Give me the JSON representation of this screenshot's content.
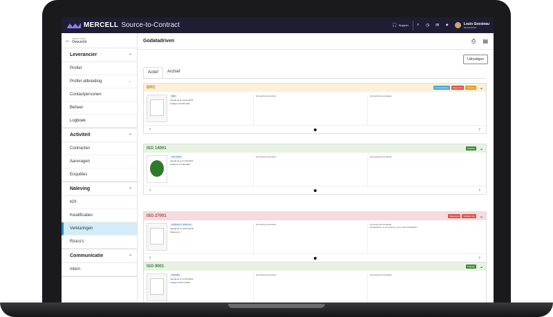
{
  "app": {
    "brand": "MERCELL",
    "product": "Source-to-Contract"
  },
  "topbar": {
    "support_label": "Support",
    "user_name": "Louis Gossieau",
    "user_role": "BEHEERDER"
  },
  "sidebar": {
    "back_small": "TERUG NAAR",
    "back_label": "Overzicht",
    "groups": [
      {
        "title": "Leverancier",
        "items": [
          "Profiel",
          "Profiel uitbreiding",
          "Contactpersonen",
          "Beheer",
          "Logboek"
        ]
      },
      {
        "title": "Activiteit",
        "items": [
          "Contracten",
          "Aanvragen",
          "Enquêtes"
        ]
      },
      {
        "title": "Naleving",
        "items": [
          "KPI",
          "Kwalificaties",
          "Verklaringen",
          "Risico's"
        ]
      },
      {
        "title": "Communicatie",
        "items": [
          "Intern"
        ]
      }
    ]
  },
  "main": {
    "title": "Godatadriven",
    "invite_label": "Uitnodigen",
    "tabs": [
      "Actief",
      "Archief"
    ],
    "col1_label": "Opmerking transmitter",
    "col2_label": "Opmerking beoordelaar",
    "cards": [
      {
        "title": "BRC",
        "file": "BRC",
        "line1": "Ingediend op 25-11-2023",
        "line2": "Geldig tot 26-05-2021",
        "col2_text": "",
        "badges": [
          {
            "label": "In behandeling",
            "color": "#4aa8d8"
          },
          {
            "label": "Uitgevoerd",
            "color": "#d9534f"
          },
          {
            "label": "Verlopen",
            "color": "#e59a2b"
          }
        ]
      },
      {
        "title": "ISO 14001",
        "file": "ISO 14001",
        "line1": "Ingediend op 27-08-2021",
        "line2": "Geldig tot 27-08-2023",
        "col2_text": "",
        "badges": [
          {
            "label": "Voldaan",
            "color": "#4a8a3a"
          }
        ]
      },
      {
        "title": "ISO 27001",
        "file": "certificate in ENG.key",
        "line1": "Ingediend op 09-09-2016",
        "line2": "Afgewezen",
        "col2_text": "Godatadriven is not listed as one of the subsidiaries.",
        "badges": [
          {
            "label": "Uitgevoerd",
            "color": "#d9534f"
          },
          {
            "label": "Voldaan niet",
            "color": "#d9534f"
          }
        ]
      },
      {
        "title": "ISO 9001",
        "file": "ISO9001",
        "line1": "Ingediend op 27-08-2021",
        "line2": "Geldig tot 09-11-2023",
        "col2_text": "",
        "badges": [
          {
            "label": "Voldaan",
            "color": "#4a8a3a"
          }
        ]
      }
    ],
    "card_colors": {
      "brc": "#fdf0d6",
      "iso14001": "#e6f3e2",
      "iso27001": "#f6dcdc",
      "iso9001": "#e6f3e2"
    }
  }
}
